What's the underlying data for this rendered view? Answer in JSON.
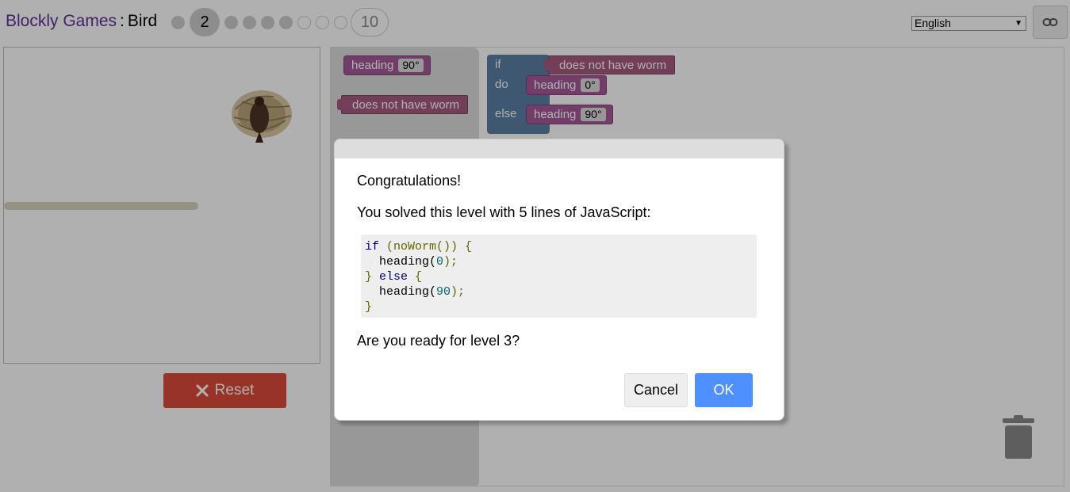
{
  "header": {
    "app_title": "Blockly Games",
    "separator": ":",
    "game_title": "Bird",
    "current_level": "2",
    "last_level": "10"
  },
  "language": {
    "selected": "English"
  },
  "reset_button": {
    "label": "Reset"
  },
  "workspace": {
    "flyout": {
      "heading_block": {
        "label": "heading",
        "value": "90°"
      },
      "worm_block": {
        "label": "does not have worm"
      }
    },
    "program": {
      "if_label": "if",
      "do_label": "do",
      "else_label": "else",
      "condition": "does not have worm",
      "do_heading": {
        "label": "heading",
        "value": "0°"
      },
      "else_heading": {
        "label": "heading",
        "value": "90°"
      }
    }
  },
  "dialog": {
    "title": "Congratulations!",
    "message": "You solved this level with 5 lines of JavaScript:",
    "code": {
      "line1_if": "if",
      "line1_rest": " (noWorm()) ",
      "line1_brace": "{",
      "line2_fn": "  heading(",
      "line2_num": "0",
      "line2_end": ");",
      "line3_open": "} ",
      "line3_else": "else",
      "line3_brace": " {",
      "line4_fn": "  heading(",
      "line4_num": "90",
      "line4_end": ");",
      "line5": "}"
    },
    "question": "Are you ready for level 3?",
    "cancel_label": "Cancel",
    "ok_label": "OK"
  },
  "colors": {
    "brand_purple": "#60309a",
    "reset_red": "#dd4b39",
    "ok_blue": "#4d90fe",
    "heading_block": "#a55b99",
    "worm_block": "#a55b80",
    "if_block": "#5b80a5"
  },
  "icons": {
    "link": "link-icon",
    "reset": "close-x-icon",
    "trash": "trash-icon",
    "dropdown": "chevron-down-icon"
  }
}
